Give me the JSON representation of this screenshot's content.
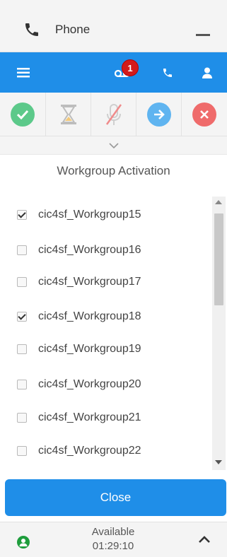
{
  "header": {
    "title": "Phone"
  },
  "toolbar": {
    "notification_count": "1"
  },
  "section_title": "Workgroup Activation",
  "workgroups": [
    {
      "name": "cic4sf_Workgroup15",
      "checked": true
    },
    {
      "name": "cic4sf_Workgroup16",
      "checked": false
    },
    {
      "name": "cic4sf_Workgroup17",
      "checked": false
    },
    {
      "name": "cic4sf_Workgroup18",
      "checked": true
    },
    {
      "name": "cic4sf_Workgroup19",
      "checked": false
    },
    {
      "name": "cic4sf_Workgroup20",
      "checked": false
    },
    {
      "name": "cic4sf_Workgroup21",
      "checked": false
    },
    {
      "name": "cic4sf_Workgroup22",
      "checked": false
    }
  ],
  "close_label": "Close",
  "status": {
    "label": "Available",
    "time": "01:29:10"
  },
  "colors": {
    "accent": "#1f8ee8",
    "accept": "#5cc98a",
    "transfer": "#5fb4f0",
    "disconnect": "#ef6b6b",
    "available": "#1e9d3c"
  },
  "icons": [
    "phone-icon",
    "menu-icon",
    "voicemail-icon",
    "phone-icon",
    "user-icon",
    "check-icon",
    "hourglass-icon",
    "mute-mic-icon",
    "arrow-right-icon",
    "close-icon",
    "chevron-down-icon",
    "chevron-up-icon"
  ]
}
